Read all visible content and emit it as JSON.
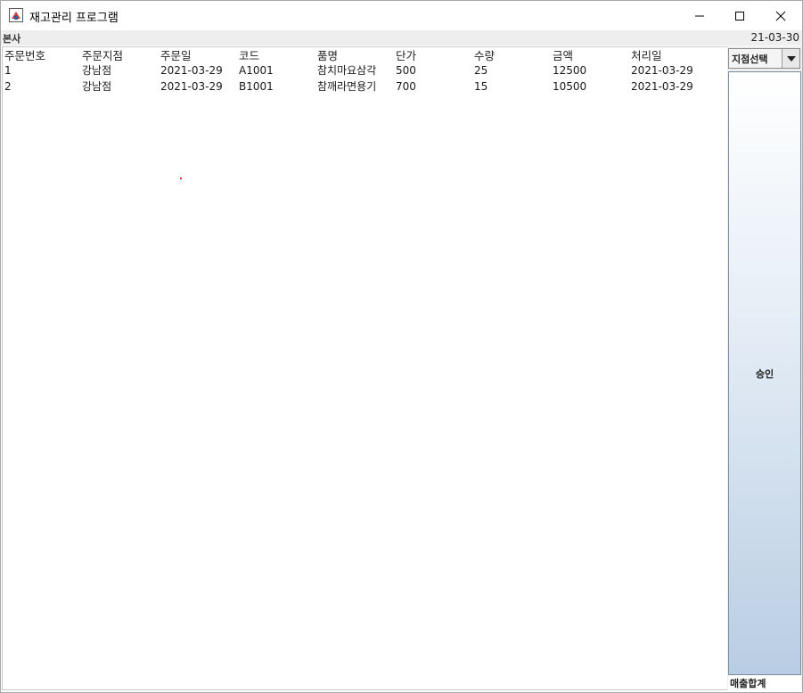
{
  "window": {
    "title": "재고관리 프로그램"
  },
  "header": {
    "branch_label": "본사",
    "date": "21-03-30"
  },
  "table": {
    "columns": [
      "주문번호",
      "주문지점",
      "주문일",
      "코드",
      "품명",
      "단가",
      "수량",
      "금액",
      "처리일"
    ],
    "rows": [
      [
        "1",
        "강남점",
        "2021-03-29",
        "A1001",
        "참치마요삼각",
        "500",
        "25",
        "12500",
        "2021-03-29"
      ],
      [
        "2",
        "강남점",
        "2021-03-29",
        "B1001",
        "참깨라면용기",
        "700",
        "15",
        "10500",
        "2021-03-29"
      ]
    ]
  },
  "side": {
    "branch_select": "지점선택",
    "approve_label": "승인",
    "sales_total_label": "매출합계"
  },
  "colors": {
    "title_bg": "#ffffff",
    "panel_bg": "#eeeeee",
    "button_gradient_end": "#b9cde3"
  }
}
